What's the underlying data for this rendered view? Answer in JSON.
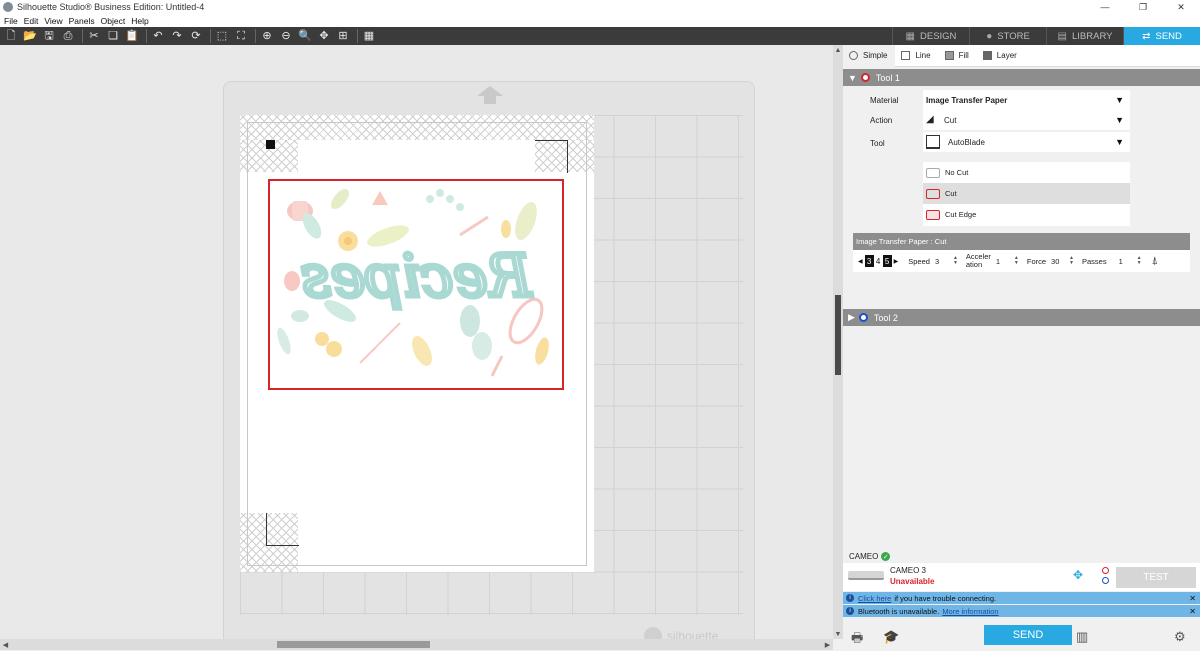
{
  "window": {
    "title": "Silhouette Studio® Business Edition: Untitled-4",
    "controls": [
      "—",
      "❐",
      "✕"
    ]
  },
  "menu": [
    "File",
    "Edit",
    "View",
    "Panels",
    "Object",
    "Help"
  ],
  "toolbar_icons": [
    "new-document-icon",
    "open-folder-icon",
    "save-icon",
    "print-icon",
    "cut-icon",
    "copy-icon",
    "paste-icon",
    "undo-icon",
    "redo-icon",
    "redraw-icon",
    "select-all-icon",
    "deselect-icon",
    "zoom-in-icon",
    "zoom-out-icon",
    "zoom-select-icon",
    "pan-icon",
    "fit-page-icon",
    "grid-icon"
  ],
  "tabs": [
    {
      "label": "DESIGN",
      "icon": "grid-icon",
      "active": false
    },
    {
      "label": "STORE",
      "icon": "store-icon",
      "active": false
    },
    {
      "label": "LIBRARY",
      "icon": "library-icon",
      "active": false
    },
    {
      "label": "SEND",
      "icon": "send-icon",
      "active": true
    }
  ],
  "canvas": {
    "mat_logo_text": "silhouette"
  },
  "send_panel": {
    "modes": [
      {
        "label": "Simple",
        "active": true
      },
      {
        "label": "Line",
        "active": false
      },
      {
        "label": "Fill",
        "active": false
      },
      {
        "label": "Layer",
        "active": false
      }
    ],
    "tool1": {
      "label": "Tool 1",
      "color": "#d9222a",
      "material_label": "Material",
      "material_value": "Image Transfer Paper",
      "action_label": "Action",
      "action_value": "Cut",
      "tool_label": "Tool",
      "tool_value": "AutoBlade",
      "cut_options": [
        {
          "label": "No Cut",
          "selected": false
        },
        {
          "label": "Cut",
          "selected": true
        },
        {
          "label": "Cut Edge",
          "selected": false
        }
      ],
      "settings_header": "Image Transfer Paper : Cut",
      "blade_digits": [
        "3",
        "4",
        "5"
      ],
      "speed_label": "Speed",
      "speed_value": "3",
      "accel_label_1": "Acceler",
      "accel_label_2": "ation",
      "accel_value": "1",
      "force_label": "Force",
      "force_value": "30",
      "passes_label": "Passes",
      "passes_value": "1"
    },
    "tool2": {
      "label": "Tool 2",
      "color": "#1b4fd6"
    },
    "device": {
      "section_label": "CAMEO",
      "name": "CAMEO 3",
      "status": "Unavailable",
      "test_label": "TEST"
    },
    "info": [
      {
        "link": "Click here",
        "text": "if you have trouble connecting."
      },
      {
        "text": "Bluetooth is unavailable.",
        "link": "More information"
      }
    ],
    "send_label": "SEND"
  },
  "colors": {
    "accent": "#29a9e1",
    "toolbar": "#3b3b3b",
    "cut_red": "#d9222a"
  }
}
